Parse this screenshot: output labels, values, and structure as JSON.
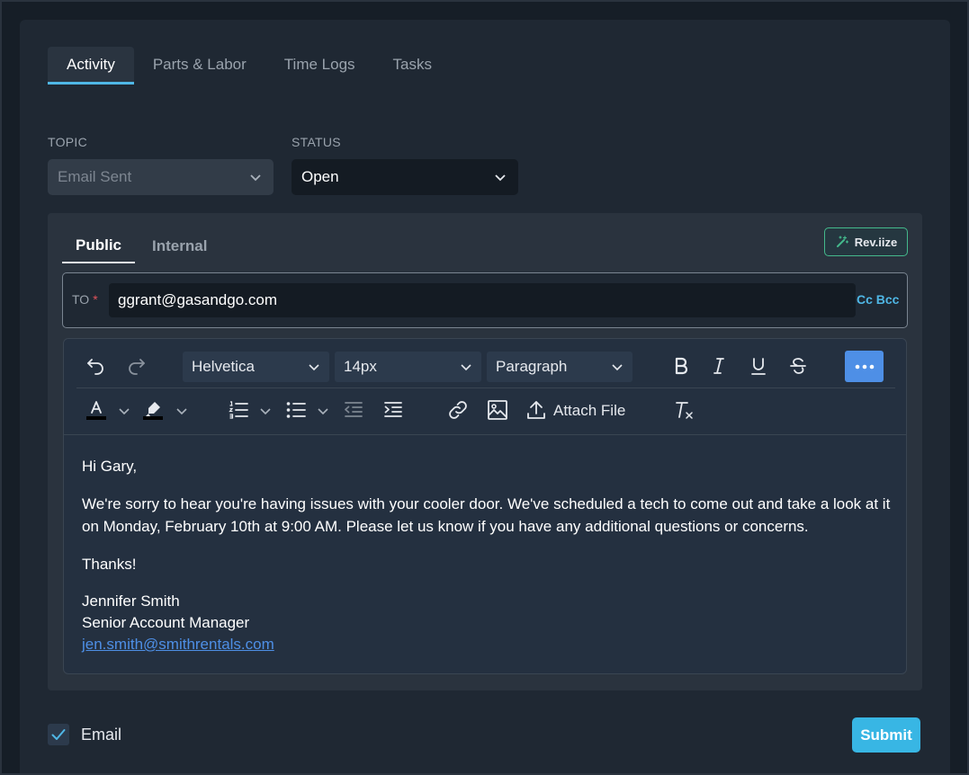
{
  "tabs": [
    {
      "label": "Activity",
      "active": true
    },
    {
      "label": "Parts & Labor",
      "active": false
    },
    {
      "label": "Time Logs",
      "active": false
    },
    {
      "label": "Tasks",
      "active": false
    }
  ],
  "topic": {
    "label": "TOPIC",
    "value": "Email Sent"
  },
  "status": {
    "label": "STATUS",
    "value": "Open"
  },
  "subtabs": [
    {
      "label": "Public",
      "active": true
    },
    {
      "label": "Internal",
      "active": false
    }
  ],
  "reviize_label": "Rev.iize",
  "to": {
    "label": "TO",
    "required_mark": "*",
    "value": "ggrant@gasandgo.com",
    "cc_bcc": "Cc Bcc"
  },
  "toolbar": {
    "font_family": "Helvetica",
    "font_size": "14px",
    "block_format": "Paragraph",
    "attach_label": "Attach File",
    "more_icon": "ellipsis-icon"
  },
  "message": {
    "greeting": "Hi Gary,",
    "body": "We're sorry to hear you're having issues with your cooler door. We've scheduled a tech to come out and take a look at it on Monday, February 10th at 9:00 AM. Please let us know if you have any additional questions or concerns.",
    "closing": "Thanks!",
    "sig_name": "Jennifer Smith",
    "sig_title": "Senior Account Manager",
    "sig_email": "jen.smith@smithrentals.com"
  },
  "footer": {
    "email_label": "Email",
    "email_checked": true,
    "submit_label": "Submit"
  },
  "colors": {
    "accent": "#38b6e4",
    "primary_blue": "#4e8fe6",
    "reviize_border": "#44b98c"
  }
}
